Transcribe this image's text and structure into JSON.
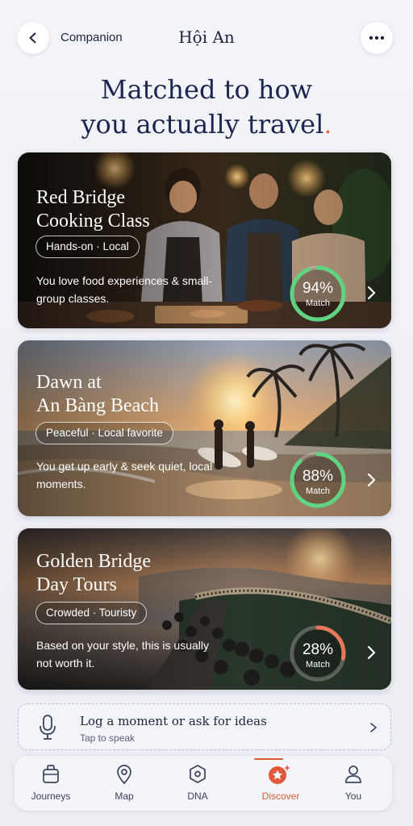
{
  "header": {
    "back_label": "Companion",
    "city": "Hội An"
  },
  "headline": {
    "line1": "Matched to how",
    "line2": "you actually travel",
    "dot": "."
  },
  "cards": [
    {
      "title_line1": "Red Bridge",
      "title_line2": "Cooking Class",
      "chip": "Hands-on · Local",
      "desc": "You love food experiences & small-group classes.",
      "match_pct": 94,
      "match_text": "94%",
      "match_label": "Match",
      "ring_color": "#5fd37f"
    },
    {
      "title_line1": "Dawn at",
      "title_line2": "An Bàng Beach",
      "chip": "Peaceful · Local favorite",
      "desc": "You get up early & seek quiet, local moments.",
      "match_pct": 88,
      "match_text": "88%",
      "match_label": "Match",
      "ring_color": "#5fd37f"
    },
    {
      "title_line1": "Golden Bridge",
      "title_line2": "Day Tours",
      "chip": "Crowded · Touristy",
      "desc": "Based on your style, this is usually not worth it.",
      "match_pct": 28,
      "match_text": "28%",
      "match_label": "Match",
      "ring_color": "#e8785c"
    }
  ],
  "log": {
    "title": "Log a moment or ask for ideas",
    "subtitle": "Tap to speak"
  },
  "tabs": [
    {
      "label": "Journeys",
      "icon": "bag-icon",
      "active": false
    },
    {
      "label": "Map",
      "icon": "map-pin-icon",
      "active": false
    },
    {
      "label": "DNA",
      "icon": "hexagon-icon",
      "active": false
    },
    {
      "label": "Discover",
      "icon": "discover-star-icon",
      "active": true
    },
    {
      "label": "You",
      "icon": "person-icon",
      "active": false
    }
  ],
  "colors": {
    "accent": "#e2583c",
    "navy": "#1b2550",
    "match_high": "#5fd37f",
    "match_low": "#e8785c"
  }
}
